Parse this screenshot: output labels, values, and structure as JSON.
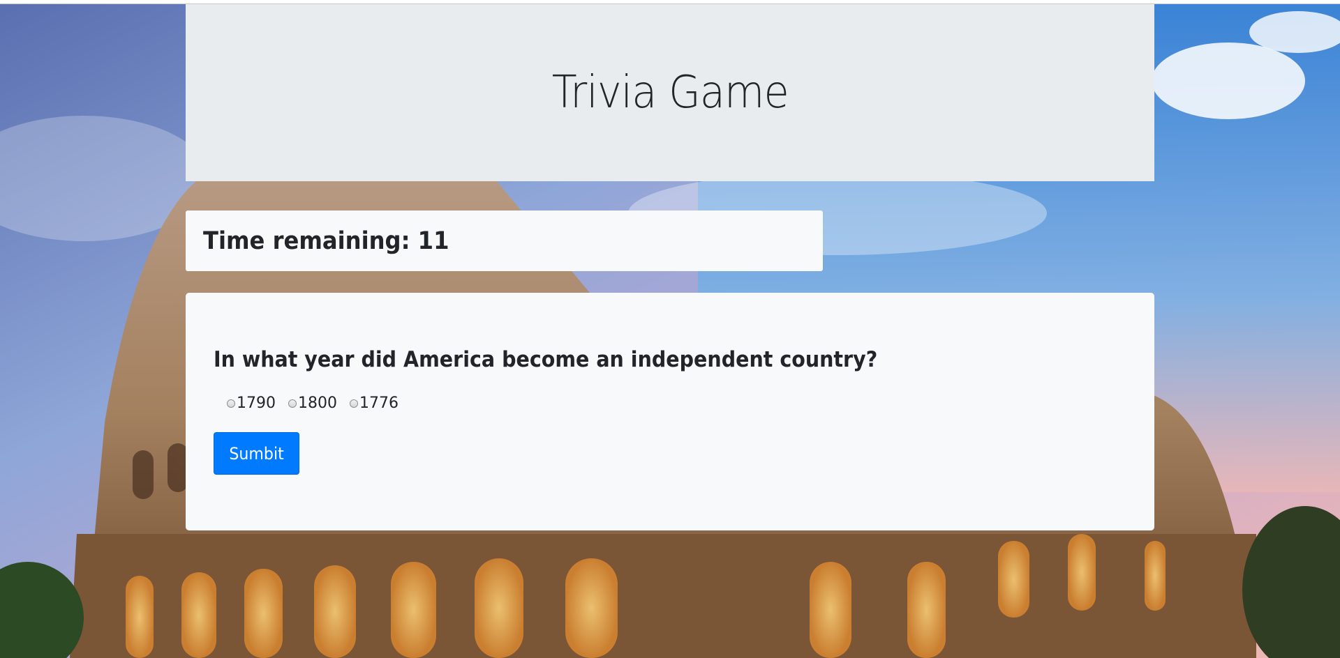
{
  "header": {
    "title": "Trivia Game"
  },
  "timer": {
    "label": "Time remaining: 11"
  },
  "question": {
    "text": "In what year did America become an independent country?",
    "options": [
      "1790",
      "1800",
      "1776"
    ],
    "submit_label": "Sumbit"
  },
  "background": {
    "subject": "colosseum-sunset-photo"
  },
  "colors": {
    "jumbotron": "#e9ecef",
    "card": "#f8f9fa",
    "button": "#007bff",
    "text": "#212529"
  }
}
